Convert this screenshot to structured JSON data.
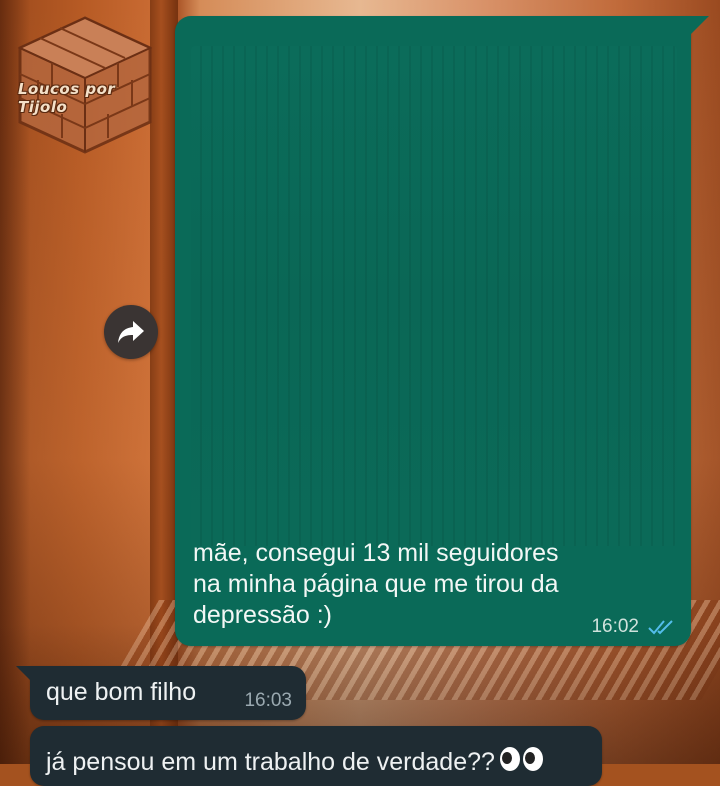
{
  "watermark": {
    "text": "Loucos por Tijolo"
  },
  "messages": {
    "outgoing": {
      "text_line1": "mãe, consegui 13 mil seguidores",
      "text_line2": "na minha página que me tirou da",
      "text_line3": "depressão :)",
      "time": "16:02",
      "status": "read",
      "status_color": "#53bdeb",
      "bubble_color": "#0a6a58"
    },
    "incoming": [
      {
        "text": "que bom filho",
        "time": "16:03"
      },
      {
        "text": "já pensou em um trabalho de verdade??",
        "emoji": "eyes"
      }
    ]
  },
  "icons": {
    "forward": "forward-arrow-icon",
    "read_ticks": "double-check-icon",
    "emoji": "eyes-emoji-icon"
  }
}
